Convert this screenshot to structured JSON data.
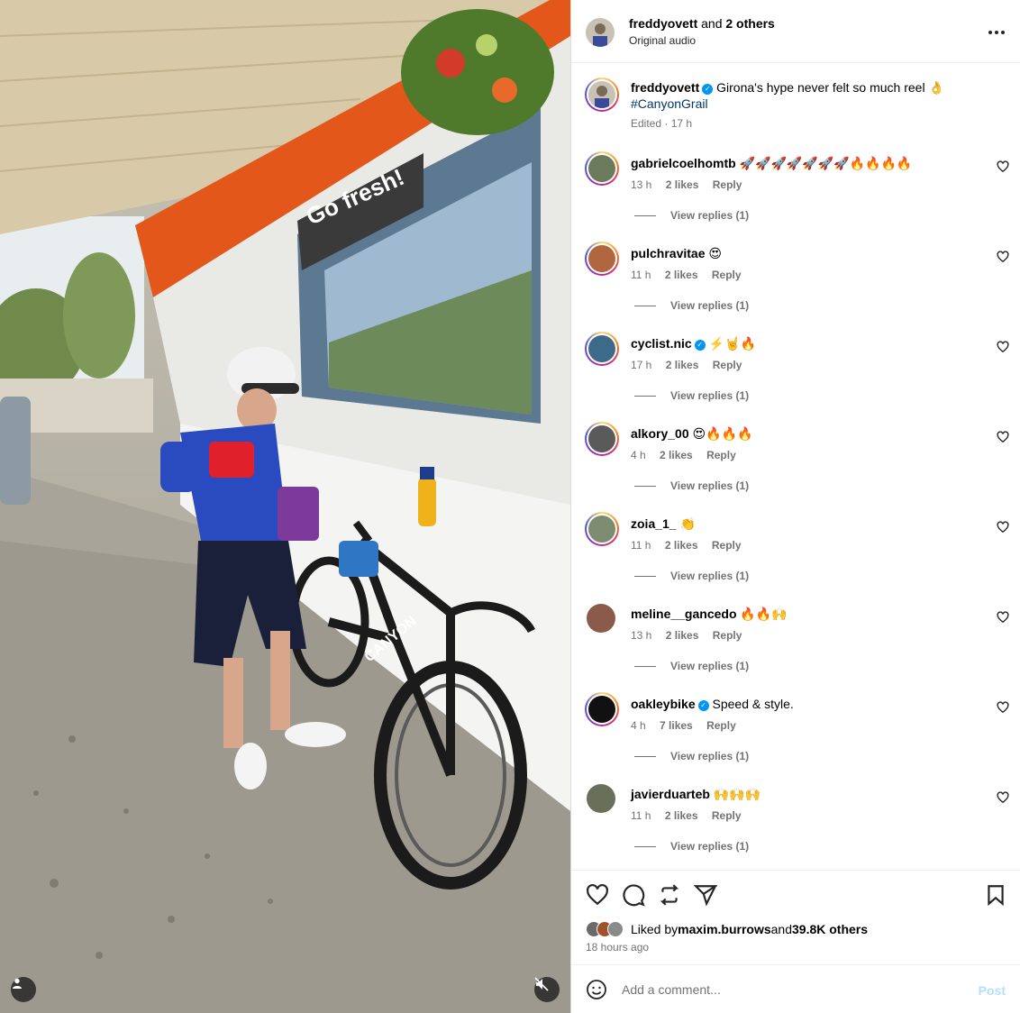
{
  "header": {
    "username": "freddyovett",
    "collab_suffix": " and ",
    "collab_count": "2 others",
    "audio": "Original audio",
    "more_icon": "more-horizontal-icon"
  },
  "caption": {
    "username": "freddyovett",
    "text": "Girona's hype never felt so much reel 👌",
    "hashtag": "#CanyonGrail",
    "edited": "Edited · 17 h"
  },
  "comments": [
    {
      "username": "gabrielcoelhomtb",
      "verified": false,
      "text": "🚀🚀🚀🚀🚀🚀🚀🔥🔥🔥🔥",
      "time": "13 h",
      "likes": "2 likes",
      "reply": "Reply",
      "view_replies": "View replies (1)",
      "ring": true,
      "avatar_color": "#6b7a5a"
    },
    {
      "username": "pulchravitae",
      "verified": false,
      "text": "😍",
      "time": "11 h",
      "likes": "2 likes",
      "reply": "Reply",
      "view_replies": "View replies (1)",
      "ring": true,
      "avatar_color": "#b0673f"
    },
    {
      "username": "cyclist.nic",
      "verified": true,
      "text": "⚡️🤘🔥",
      "time": "17 h",
      "likes": "2 likes",
      "reply": "Reply",
      "view_replies": "View replies (1)",
      "ring": true,
      "avatar_color": "#3e6a8a"
    },
    {
      "username": "alkory_00",
      "verified": false,
      "text": "😍🔥🔥🔥",
      "time": "4 h",
      "likes": "2 likes",
      "reply": "Reply",
      "view_replies": "View replies (1)",
      "ring": true,
      "avatar_color": "#5a5a5a"
    },
    {
      "username": "zoia_1_",
      "verified": false,
      "text": "👏",
      "time": "11 h",
      "likes": "2 likes",
      "reply": "Reply",
      "view_replies": "View replies (1)",
      "ring": true,
      "avatar_color": "#7d8c70"
    },
    {
      "username": "meline__gancedo",
      "verified": false,
      "text": "🔥🔥🙌",
      "time": "13 h",
      "likes": "2 likes",
      "reply": "Reply",
      "view_replies": "View replies (1)",
      "ring": false,
      "avatar_color": "#8a5a4a"
    },
    {
      "username": "oakleybike",
      "verified": true,
      "text": "Speed & style.",
      "time": "4 h",
      "likes": "7 likes",
      "reply": "Reply",
      "view_replies": "View replies (1)",
      "ring": true,
      "avatar_color": "#111111"
    },
    {
      "username": "javierduarteb",
      "verified": false,
      "text": "🙌🙌🙌",
      "time": "11 h",
      "likes": "2 likes",
      "reply": "Reply",
      "view_replies": "View replies (1)",
      "ring": false,
      "avatar_color": "#6a6f5a"
    }
  ],
  "actions": {
    "like_icon": "heart-icon",
    "comment_icon": "comment-icon",
    "repost_icon": "repost-icon",
    "share_icon": "send-icon",
    "save_icon": "bookmark-icon"
  },
  "likes": {
    "prefix": "Liked by ",
    "user": "maxim.burrows",
    "middle": " and ",
    "count": "39.8K others"
  },
  "timestamp": "18 hours ago",
  "composer": {
    "placeholder": "Add a comment...",
    "post_label": "Post",
    "emoji_icon": "smiley-icon"
  },
  "media": {
    "store_sign": "Go fresh!",
    "bike_brand": "CANYON",
    "user_icon": "user-tag-icon",
    "mute_icon": "muted-speaker-icon"
  },
  "colors": {
    "accent_blue": "#0095f6",
    "hashtag": "#00376b",
    "muted_text": "#737373",
    "post_disabled": "#b2dffc"
  }
}
